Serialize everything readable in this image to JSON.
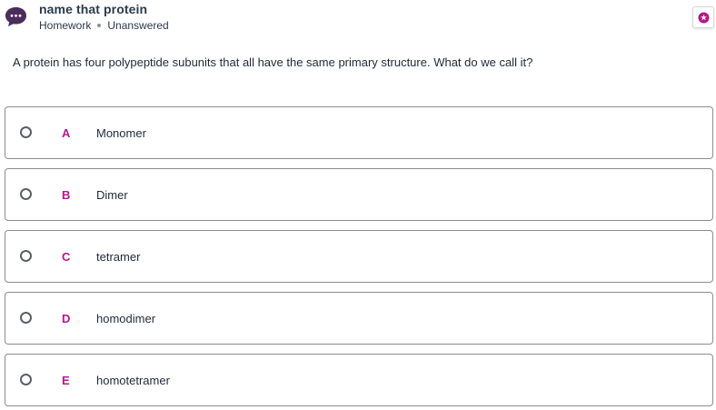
{
  "header": {
    "title": "name that protein",
    "category": "Homework",
    "status": "Unanswered",
    "avatar_icon": "chat-bubble-ellipsis-icon",
    "corner_icon": "star-badge-icon",
    "accent_color": "#4b2c5a",
    "badge_color": "#b5178c"
  },
  "question": {
    "text": "A protein has four polypeptide subunits that all have the same primary structure. What do we call it?"
  },
  "options": [
    {
      "letter": "A",
      "label": "Monomer"
    },
    {
      "letter": "B",
      "label": "Dimer"
    },
    {
      "letter": "C",
      "label": "tetramer"
    },
    {
      "letter": "D",
      "label": "homodimer"
    },
    {
      "letter": "E",
      "label": "homotetramer"
    }
  ]
}
